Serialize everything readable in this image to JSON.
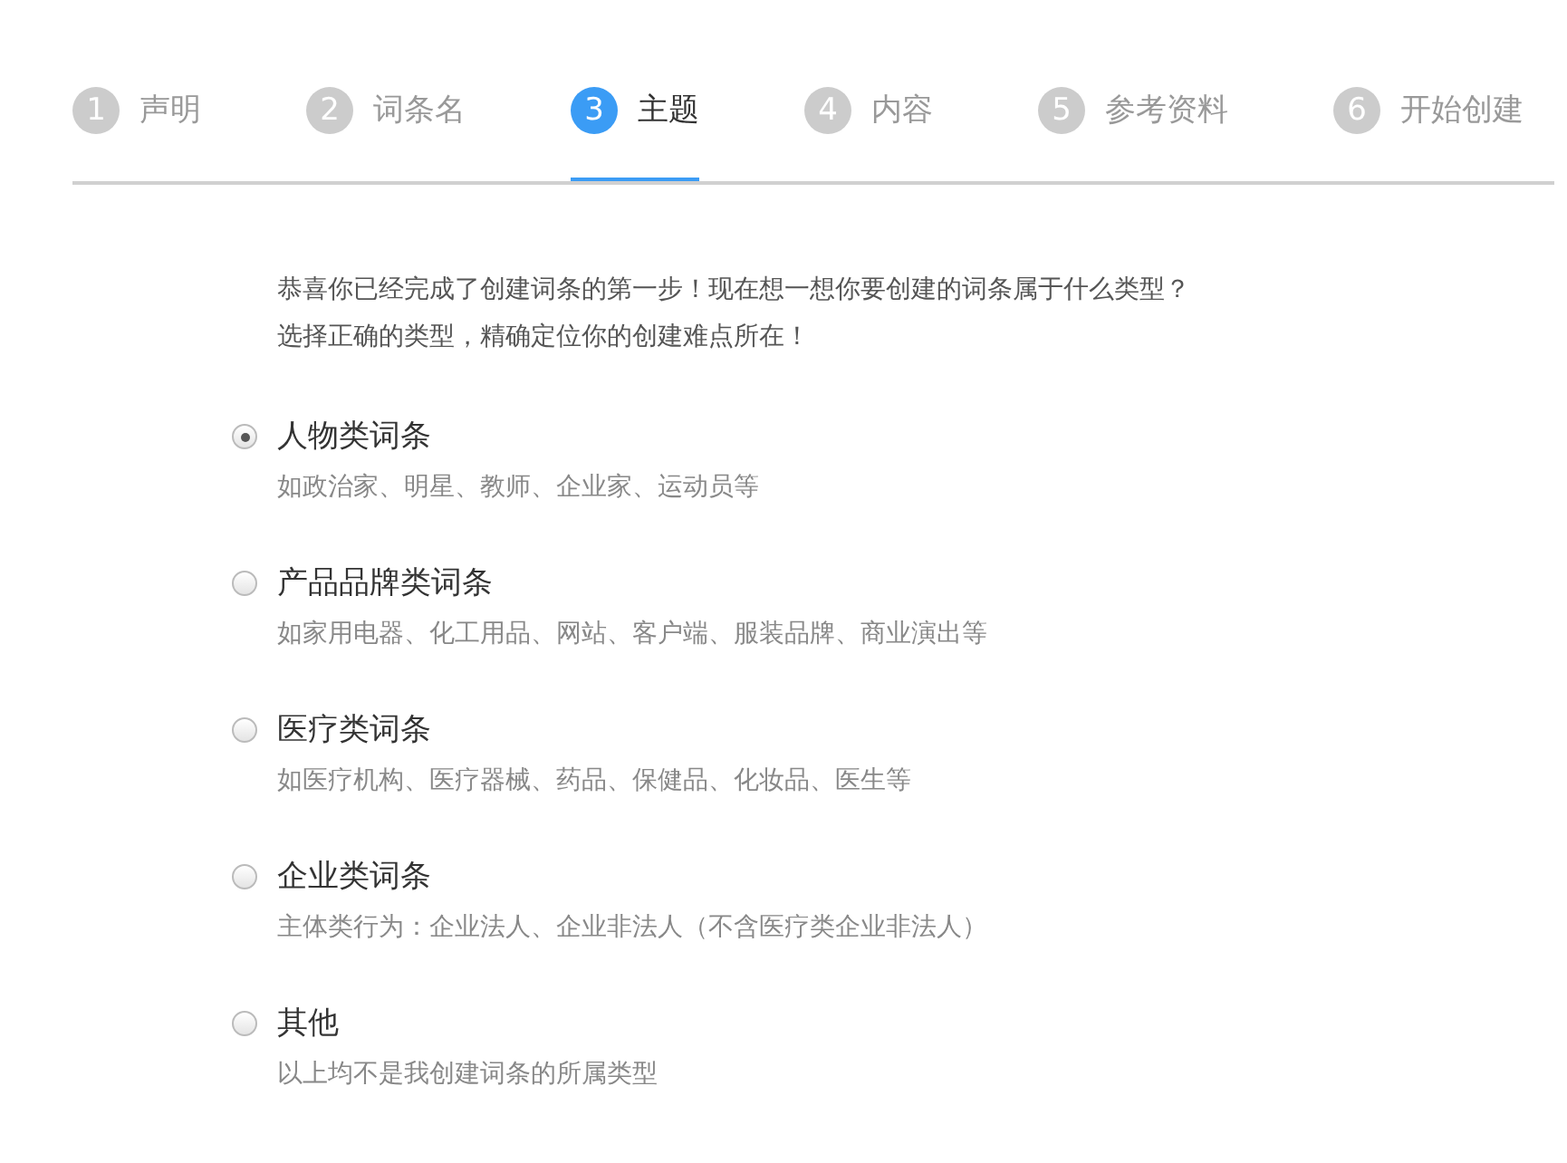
{
  "steps": [
    {
      "number": "1",
      "label": "声明",
      "selected": false
    },
    {
      "number": "2",
      "label": "词条名",
      "selected": false
    },
    {
      "number": "3",
      "label": "主题",
      "selected": true
    },
    {
      "number": "4",
      "label": "内容",
      "selected": false
    },
    {
      "number": "5",
      "label": "参考资料",
      "selected": false
    },
    {
      "number": "6",
      "label": "开始创建",
      "selected": false
    }
  ],
  "intro": [
    "恭喜你已经完成了创建词条的第一步！现在想一想你要创建的词条属于什么类型？",
    "选择正确的类型，精确定位你的创建难点所在！"
  ],
  "options": [
    {
      "label": "人物类词条",
      "description": "如政治家、明星、教师、企业家、运动员等",
      "selected": true
    },
    {
      "label": "产品品牌类词条",
      "description": "如家用电器、化工用品、网站、客户端、服装品牌、商业演出等",
      "selected": false
    },
    {
      "label": "医疗类词条",
      "description": "如医疗机构、医疗器械、药品、保健品、化妆品、医生等",
      "selected": false
    },
    {
      "label": "企业类词条",
      "description": "主体类行为：企业法人、企业非法人（不含医疗类企业非法人）",
      "selected": false
    },
    {
      "label": "其他",
      "description": "以上均不是我创建词条的所属类型",
      "selected": false
    }
  ]
}
